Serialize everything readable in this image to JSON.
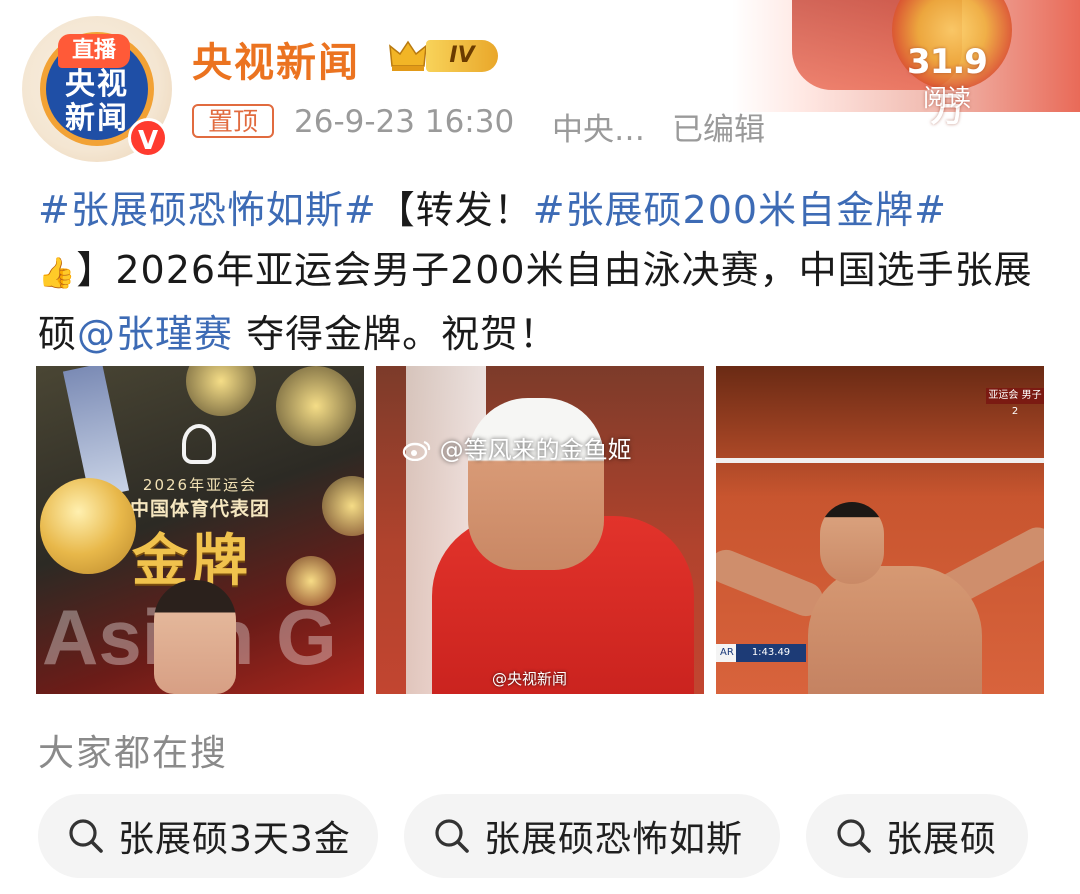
{
  "header": {
    "avatar_text_line1": "央视",
    "avatar_text_line2": "新闻",
    "live_badge": "直播",
    "verified_mark": "V",
    "account_name": "央视新闻",
    "level_badge": "IV",
    "pinned_label": "置顶",
    "post_time": "26-9-23 16:30",
    "source": "中央…",
    "edited_label": "已编辑",
    "read_count": "31.9万",
    "read_label": "阅读"
  },
  "post": {
    "hashtag1": "#张展硕恐怖如斯#",
    "bracket_open": "【转发！",
    "hashtag2": "#张展硕200米自金牌#",
    "thumb_emoji": "👍",
    "text1": "】2026年亚运会男子200米自由泳决赛，中国选手张展硕",
    "mention": "@张瑾赛",
    "text2": " 夺得金牌。祝贺！"
  },
  "images": {
    "img1": {
      "games_caption": "2026年亚运会",
      "team_caption": "中国体育代表团",
      "gold_caption": "金牌",
      "bg_text": "Asian G"
    },
    "img2": {
      "watermark": "@等风来的金鱼姬",
      "source_watermark": "@央视新闻"
    },
    "img3": {
      "broadcast_tag": "亚运会 男子2",
      "result_tag": "AR",
      "time_tag": "1:43.49"
    }
  },
  "searches": {
    "heading": "大家都在搜",
    "items": [
      {
        "label": "张展硕3天3金"
      },
      {
        "label": "张展硕恐怖如斯"
      },
      {
        "label": "张展硕"
      }
    ]
  },
  "colors": {
    "account_name": "#eb7320",
    "hashtag": "#3d6bb5",
    "meta": "#9a9a9a"
  }
}
